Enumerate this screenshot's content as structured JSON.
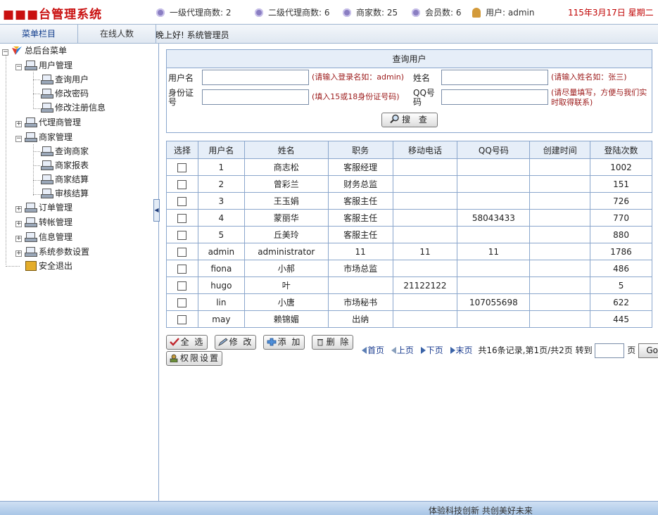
{
  "header": {
    "brand": "■■■台管理系统",
    "stats": [
      {
        "label": "一级代理商数: 2"
      },
      {
        "label": "二级代理商数: 6"
      },
      {
        "label": "商家数: 25"
      },
      {
        "label": "会员数: 6"
      }
    ],
    "user": "用户: admin",
    "date": "115年3月17日 星期二"
  },
  "navbar": {
    "menu_tab": "菜单栏目",
    "online_tab": "在线人数",
    "greeting": "晚上好! 系统管理员"
  },
  "sidebar": {
    "root": "总后台菜单",
    "user_mgmt": "用户管理",
    "query_user": "查询用户",
    "change_pwd": "修改密码",
    "change_reg": "修改注册信息",
    "agent_mgmt": "代理商管理",
    "merchant_mgmt": "商家管理",
    "query_merchant": "查询商家",
    "merchant_report": "商家报表",
    "merchant_settle": "商家结算",
    "audit_settle": "审核结算",
    "order_mgmt": "订单管理",
    "transfer_mgmt": "转帐管理",
    "info_mgmt": "信息管理",
    "sys_params": "系统参数设置",
    "logout": "安全退出"
  },
  "search": {
    "title": "查询用户",
    "username_label": "用户名",
    "username_value": "",
    "username_hint": "(请输入登录名如：admin)",
    "name_label": "姓名",
    "name_value": "",
    "name_hint": "(请输入姓名如：张三)",
    "id_label": "身份证号",
    "id_value": "",
    "id_hint": "(填入15或18身份证号码)",
    "qq_label": "QQ号码",
    "qq_value": "",
    "qq_hint": "(请尽量填写，方便与我们实时取得联系)",
    "button": "搜 查"
  },
  "table": {
    "headers": [
      "选择",
      "用户名",
      "姓名",
      "职务",
      "移动电话",
      "QQ号码",
      "创建时间",
      "登陆次数"
    ],
    "rows": [
      [
        "1",
        "商志松",
        "客服经理",
        "",
        "",
        "",
        "1002"
      ],
      [
        "2",
        "曾彩兰",
        "财务总监",
        "",
        "",
        "",
        "151"
      ],
      [
        "3",
        "王玉娟",
        "客服主任",
        "",
        "",
        "",
        "726"
      ],
      [
        "4",
        "蒙丽华",
        "客服主任",
        "",
        "58043433",
        "",
        "770"
      ],
      [
        "5",
        "丘美玲",
        "客服主任",
        "",
        "",
        "",
        "880"
      ],
      [
        "admin",
        "administrator",
        "11",
        "11",
        "11",
        "",
        "1786"
      ],
      [
        "fiona",
        "小郝",
        "市场总监",
        "",
        "",
        "",
        "486"
      ],
      [
        "hugo",
        "叶",
        "",
        "21122122",
        "",
        "",
        "5"
      ],
      [
        "lin",
        "小唐",
        "市场秘书",
        "",
        "107055698",
        "",
        "622"
      ],
      [
        "may",
        "赖锦媚",
        "出纳",
        "",
        "",
        "",
        "445"
      ]
    ]
  },
  "actions": {
    "select_all": "全 选",
    "edit": "修 改",
    "add": "添 加",
    "delete": "删 除",
    "permissions": "权限设置"
  },
  "pager": {
    "first": "首页",
    "prev": "上页",
    "next": "下页",
    "last": "末页",
    "summary": "共16条记录,第1页/共2页 转到",
    "page_unit": "页",
    "goto_value": "",
    "go": "Go!"
  },
  "footer": {
    "text": "体验科技创新  共创美好未来"
  }
}
